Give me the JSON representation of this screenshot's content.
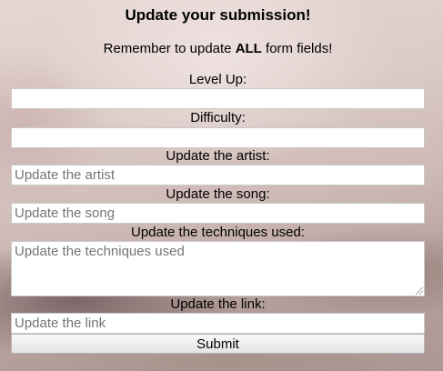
{
  "form": {
    "title": "Update your submission!",
    "reminder_prefix": "Remember to update ",
    "reminder_bold": "ALL",
    "reminder_suffix": " form fields!",
    "fields": [
      {
        "label": "Level Up:",
        "placeholder": "",
        "value": ""
      },
      {
        "label": "Difficulty:",
        "placeholder": "",
        "value": ""
      },
      {
        "label": "Update the artist:",
        "placeholder": "Update the artist",
        "value": ""
      },
      {
        "label": "Update the song:",
        "placeholder": "Update the song",
        "value": ""
      },
      {
        "label": "Update the techniques used:",
        "placeholder": "Update the techniques used",
        "value": ""
      },
      {
        "label": "Update the link:",
        "placeholder": "Update the link",
        "value": ""
      }
    ],
    "submit_label": "Submit"
  }
}
